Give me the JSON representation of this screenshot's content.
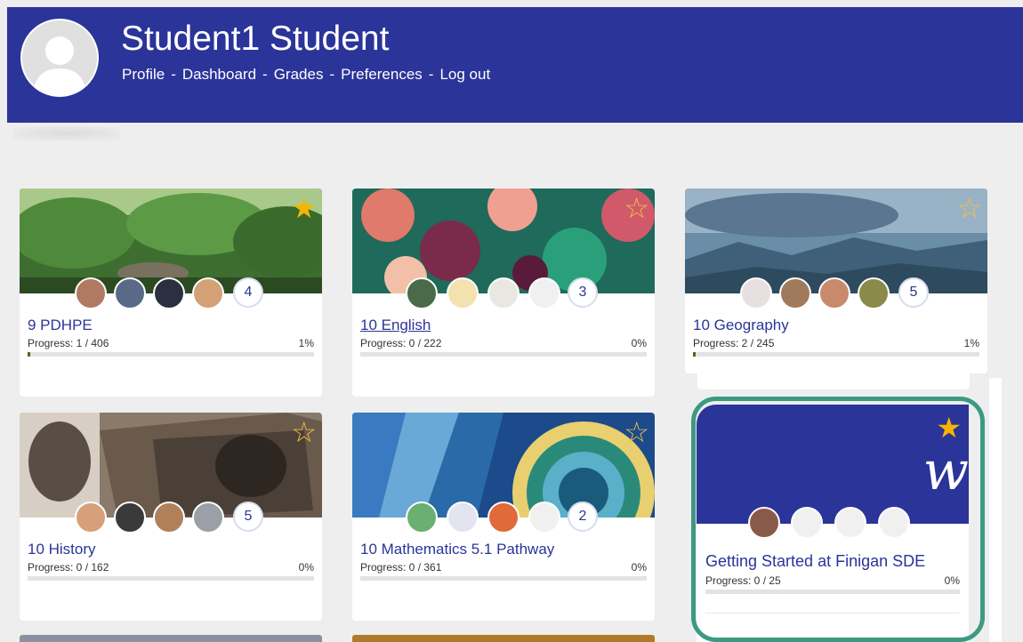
{
  "user": {
    "name": "Student1 Student",
    "nav": [
      "Profile",
      "Dashboard",
      "Grades",
      "Preferences",
      "Log out"
    ],
    "nav_separator": "-"
  },
  "courses": [
    {
      "title": "9 PDHPE",
      "progress_text": "Progress: 1 / 406",
      "percent": "1%",
      "progress_value": 0.01,
      "avatar_count": "4",
      "starred": true,
      "underlined": false
    },
    {
      "title": "10 English",
      "progress_text": "Progress: 0 / 222",
      "percent": "0%",
      "progress_value": 0,
      "avatar_count": "3",
      "starred": false,
      "underlined": true
    },
    {
      "title": "10 Geography",
      "progress_text": "Progress: 2 / 245",
      "percent": "1%",
      "progress_value": 0.01,
      "avatar_count": "5",
      "starred": false,
      "underlined": false
    },
    {
      "title": "10 History",
      "progress_text": "Progress: 0 / 162",
      "percent": "0%",
      "progress_value": 0,
      "avatar_count": "5",
      "starred": false,
      "underlined": false
    },
    {
      "title": "10 Mathematics 5.1 Pathway",
      "progress_text": "Progress: 0 / 361",
      "percent": "0%",
      "progress_value": 0,
      "avatar_count": "2",
      "starred": false,
      "underlined": false
    }
  ],
  "featured": {
    "title": "Getting Started at Finigan SDE",
    "progress_text": "Progress: 0 / 25",
    "percent": "0%",
    "progress_value": 0,
    "banner_glyph": "w",
    "starred": true
  },
  "icons": {
    "star_filled": "star-filled-icon",
    "star_outline": "star-outline-icon",
    "avatar": "user-avatar-icon"
  },
  "colors": {
    "brand": "#2b3499",
    "accent_star": "#f7b500",
    "highlight": "#3d9a82"
  }
}
